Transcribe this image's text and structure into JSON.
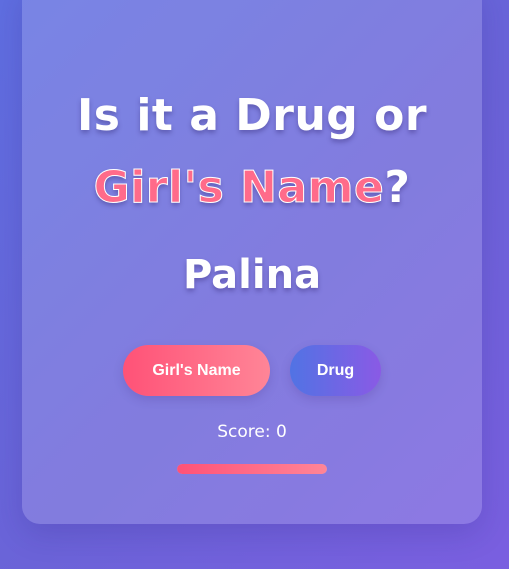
{
  "game": {
    "title_line1": "Is it a Drug or",
    "title_accent": "Girl's Name",
    "title_end": "?",
    "current_word": "Palina",
    "buttons": {
      "girl_label": "Girl's Name",
      "drug_label": "Drug"
    },
    "score_label": "Score: 0",
    "progress": 1.0
  },
  "colors": {
    "accent_pink": "#ff6b8a",
    "girl_button_start": "#ff5277",
    "girl_button_end": "#ff8597",
    "drug_button_start": "#5173e4",
    "drug_button_end": "#8a5ae5",
    "background": "#6b63d8"
  }
}
